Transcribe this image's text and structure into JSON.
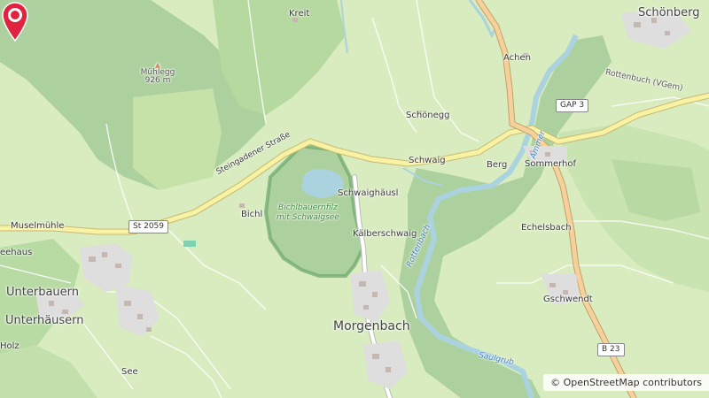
{
  "map": {
    "places": {
      "kreit": "Kreit",
      "schoenberg": "Schönberg",
      "muehlegg": "Mühlegg",
      "muehlegg_ele": "926 m",
      "achen": "Achen",
      "schoenegg": "Schönegg",
      "schwaig": "Schwaig",
      "berg": "Berg",
      "sommerhof": "Sommerhof",
      "schwaighaeusl": "Schwaighäusl",
      "bichl": "Bichl",
      "muselmuehle": "Muselmühle",
      "eehaus": "eehaus",
      "kaelberschwaig": "Kälberschwaig",
      "echelsbach": "Echelsbach",
      "unterbauern": "Unterbauern",
      "unterhaeusern": "Unterhäusern",
      "gschwendt": "Gschwendt",
      "morgenbach": "Morgenbach",
      "holz": "Holz",
      "see": "See"
    },
    "roads": {
      "steingadener": "Steingadener Straße",
      "st2059": "St 2059",
      "gap3": "GAP 3",
      "b23": "B 23",
      "rottenbuch": "Rottenbuch (VGem)"
    },
    "water": {
      "ammer": "Ammer",
      "rottenbach": "Rottenbach",
      "saulgrub": "Saulgrub"
    },
    "nature": {
      "reserve_line1": "Bichlbauernfilz",
      "reserve_line2": "mit Schwaigsee"
    },
    "icons": {
      "peak": "peak-icon",
      "marker": "location-pin-icon"
    },
    "colors": {
      "meadow": "#d9ecbf",
      "forest": "#add19e",
      "water": "#aad3df",
      "main_road": "#f8f2a4",
      "primary_road": "#f6d19b",
      "marker": "#e0243f",
      "reserve_border": "#6aa76a"
    }
  },
  "attribution": {
    "symbol": "©",
    "text": "OpenStreetMap contributors"
  }
}
